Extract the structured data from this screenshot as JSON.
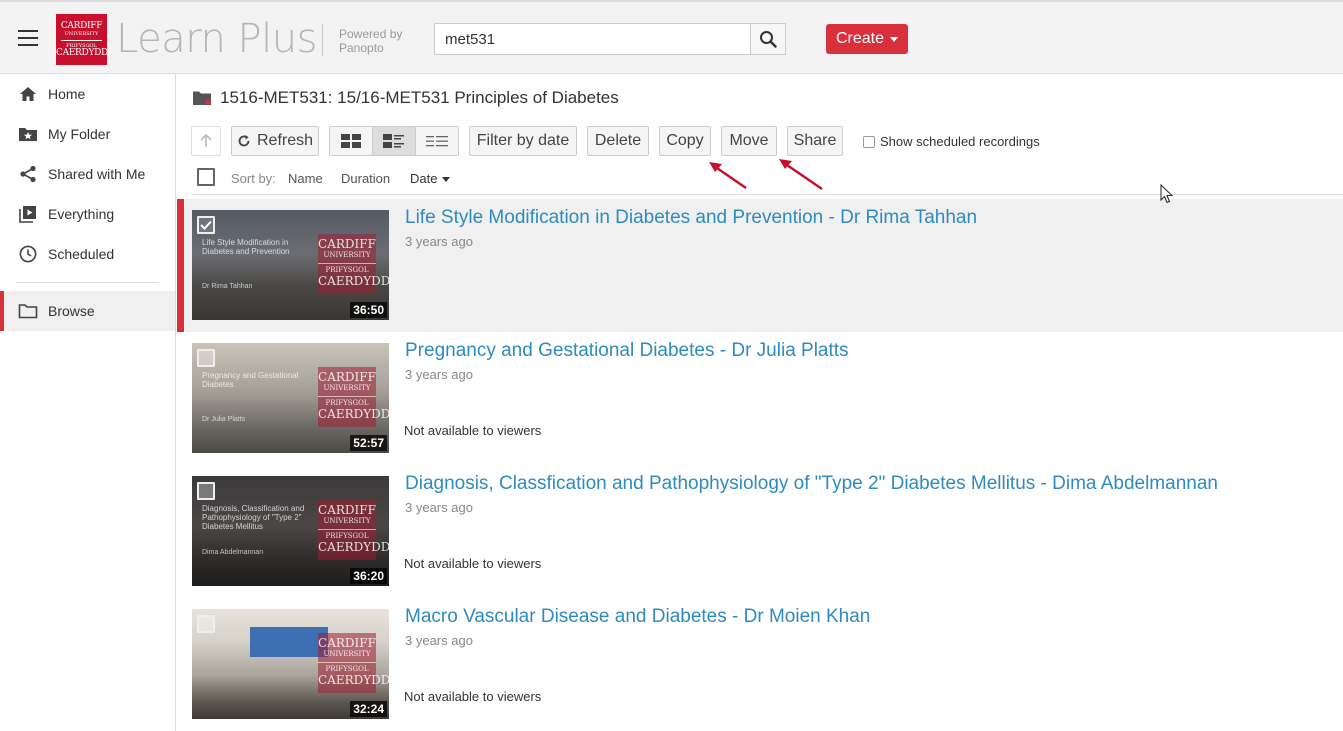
{
  "header": {
    "logo": {
      "line1": "CARDIFF",
      "line2": "UNIVERSITY",
      "line3": "PRIFYSGOL",
      "line4": "CAERDYDD"
    },
    "app_title": "Learn Plus",
    "powered_by": "Powered by Panopto",
    "search_value": "met531",
    "create_label": "Create",
    "brand_color": "#d9303e"
  },
  "sidebar": {
    "items": [
      {
        "label": "Home",
        "icon": "home-icon"
      },
      {
        "label": "My Folder",
        "icon": "star-folder-icon"
      },
      {
        "label": "Shared with Me",
        "icon": "share-icon"
      },
      {
        "label": "Everything",
        "icon": "play-library-icon"
      },
      {
        "label": "Scheduled",
        "icon": "clock-icon"
      },
      {
        "label": "Browse",
        "icon": "folder-icon"
      }
    ],
    "active": "Browse"
  },
  "main": {
    "folder_title": "1516-MET531: 15/16-MET531 Principles of Diabetes",
    "toolbar": {
      "refresh": "Refresh",
      "filter_by_date": "Filter by date",
      "delete": "Delete",
      "copy": "Copy",
      "move": "Move",
      "share": "Share",
      "show_scheduled": "Show scheduled recordings"
    },
    "sort": {
      "label": "Sort by:",
      "name": "Name",
      "duration": "Duration",
      "date": "Date"
    },
    "sessions": [
      {
        "title": "Life Style Modification in Diabetes and Prevention - Dr Rima Tahhan",
        "age": "3 years ago",
        "duration": "36:50",
        "status": "",
        "selected": true
      },
      {
        "title": "Pregnancy and Gestational Diabetes - Dr Julia Platts",
        "age": "3 years ago",
        "duration": "52:57",
        "status": "Not available to viewers",
        "selected": false
      },
      {
        "title": "Diagnosis, Classfication and Pathophysiology of \"Type 2\" Diabetes Mellitus - Dima Abdelmannan",
        "age": "3 years ago",
        "duration": "36:20",
        "status": "Not available to viewers",
        "selected": false
      },
      {
        "title": "Macro Vascular Disease and Diabetes - Dr Moien Khan",
        "age": "3 years ago",
        "duration": "32:24",
        "status": "Not available to viewers",
        "selected": false
      }
    ]
  }
}
